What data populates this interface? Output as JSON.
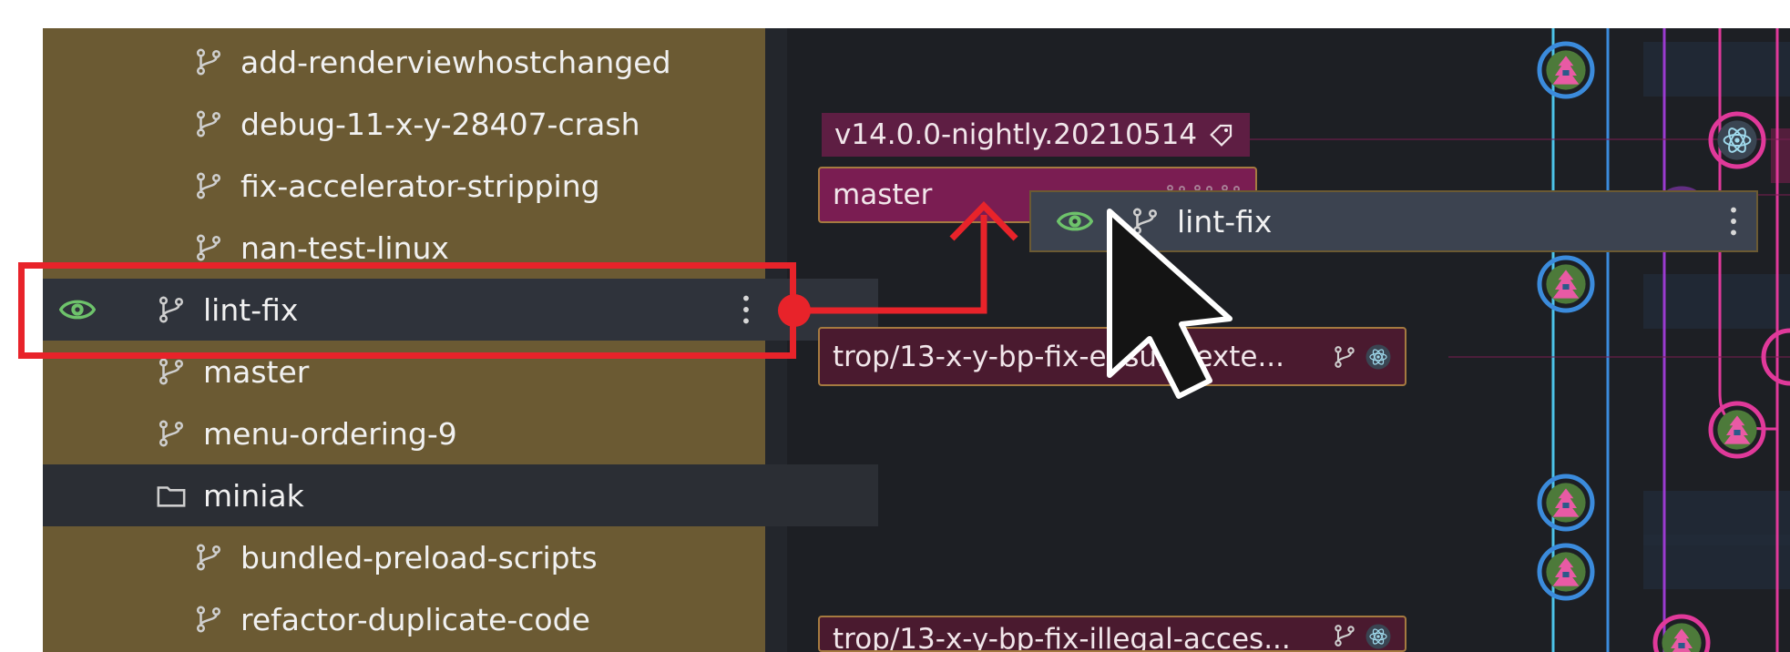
{
  "sidebar": {
    "items": [
      {
        "label": "add-renderviewhostchanged",
        "kind": "branch",
        "level": "sub"
      },
      {
        "label": "debug-11-x-y-28407-crash",
        "kind": "branch",
        "level": "sub"
      },
      {
        "label": "fix-accelerator-stripping",
        "kind": "branch",
        "level": "sub"
      },
      {
        "label": "nan-test-linux",
        "kind": "branch",
        "level": "sub"
      },
      {
        "label": "lint-fix",
        "kind": "branch",
        "level": "top",
        "selected": true,
        "visible_eye": true
      },
      {
        "label": "master",
        "kind": "branch",
        "level": "top"
      },
      {
        "label": "menu-ordering-9",
        "kind": "branch",
        "level": "top"
      },
      {
        "label": "miniak",
        "kind": "folder",
        "level": "top"
      },
      {
        "label": "bundled-preload-scripts",
        "kind": "branch",
        "level": "sub"
      },
      {
        "label": "refactor-duplicate-code",
        "kind": "branch",
        "level": "sub"
      }
    ]
  },
  "graph": {
    "tags": {
      "version": "v14.0.0-nightly.20210514",
      "master": "master",
      "trop1": "trop/13-x-y-bp-fix-ensure-exte...",
      "trop2": "trop/13-x-y-bp-fix-illegal-acces..."
    },
    "drag_card": {
      "label": "lint-fix"
    }
  },
  "colors": {
    "sidebar_bg": "#6b5a33",
    "selected_row": "#2f333b",
    "folder_row": "#2b2e34",
    "graph_bg": "#1d1f24",
    "annotation_red": "#e8232a",
    "eye_green": "#6ec36b",
    "lane_blue": "#3b8bdc",
    "lane_cyan": "#4cc3e8",
    "lane_purple": "#9b3bd0",
    "lane_pink": "#e0399a"
  },
  "icons": {
    "branch": "git-branch-icon",
    "folder": "folder-icon",
    "eye": "eye-icon",
    "tag": "tag-icon",
    "menu": "kebab-menu-icon",
    "avatar": "electron-avatar-icon",
    "cursor": "mouse-pointer-icon"
  }
}
